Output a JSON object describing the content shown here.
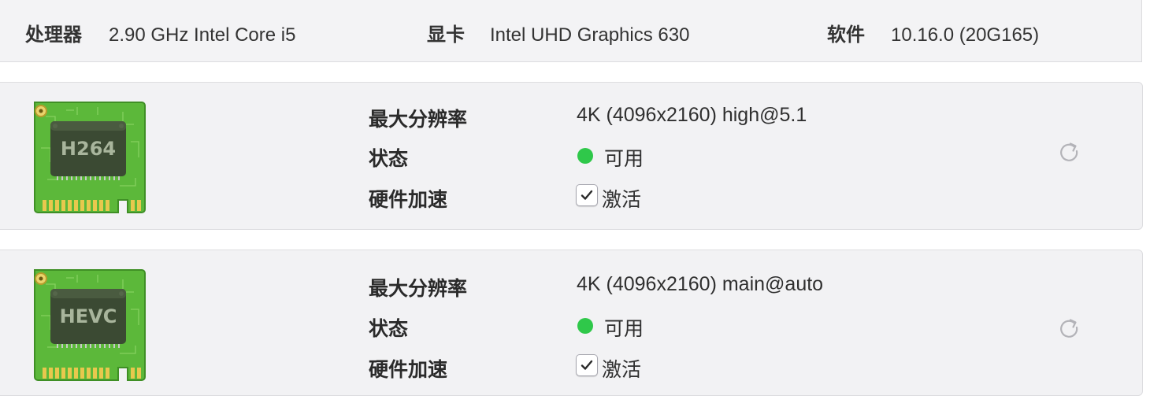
{
  "system": {
    "cpu_label": "处理器",
    "cpu_value": "2.90 GHz Intel Core i5",
    "gpu_label": "显卡",
    "gpu_value": "Intel UHD Graphics 630",
    "software_label": "软件",
    "software_value": "10.16.0 (20G165)"
  },
  "codecs": [
    {
      "chip_label": "H264",
      "max_res_label": "最大分辨率",
      "max_res_value": "4K (4096x2160) high@5.1",
      "status_label": "状态",
      "status_value": "可用",
      "status_color": "#2fc84a",
      "hw_accel_label": "硬件加速",
      "hw_accel_checkbox_label": "激活",
      "hw_accel_checked": true,
      "refresh_icon": "refresh-icon"
    },
    {
      "chip_label": "HEVC",
      "max_res_label": "最大分辨率",
      "max_res_value": "4K (4096x2160) main@auto",
      "status_label": "状态",
      "status_value": "可用",
      "status_color": "#2fc84a",
      "hw_accel_label": "硬件加速",
      "hw_accel_checkbox_label": "激活",
      "hw_accel_checked": true,
      "refresh_icon": "refresh-icon"
    }
  ]
}
